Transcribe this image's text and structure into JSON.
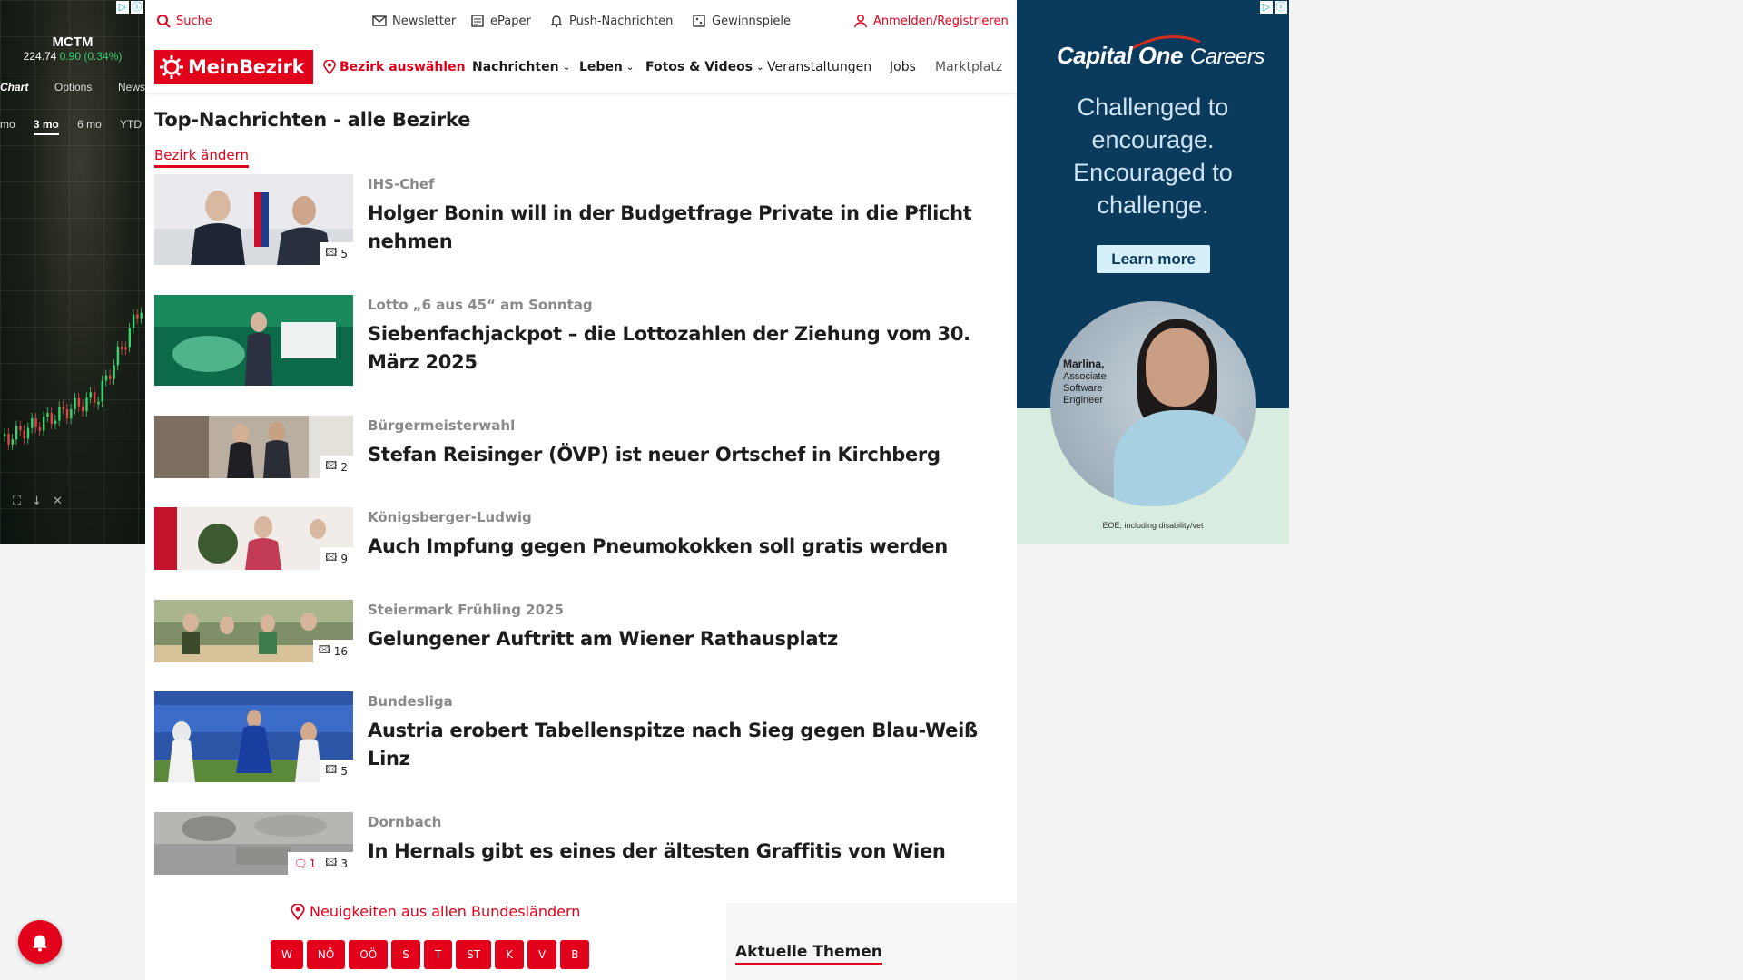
{
  "left_ad": {
    "symbol": "MCTM",
    "price": "224.74",
    "change": "0.90 (0.34%)",
    "tabs": [
      "Chart",
      "Options",
      "News"
    ],
    "ranges": [
      "mo",
      "3 mo",
      "6 mo",
      "YTD"
    ],
    "active_range": "3 mo",
    "colors": {
      "up": "#38d36e",
      "down": "#e24444"
    }
  },
  "util": {
    "search": "Suche",
    "newsletter": "Newsletter",
    "epaper": "ePaper",
    "push": "Push-Nachrichten",
    "games": "Gewinnspiele",
    "login": "Anmelden/Registrieren"
  },
  "nav": {
    "logo": "MeinBezirk",
    "select_district": "Bezirk auswählen",
    "items": [
      "Nachrichten",
      "Leben",
      "Fotos & Videos",
      "Veranstaltungen",
      "Jobs",
      "Marktplatz"
    ]
  },
  "section": {
    "title": "Top-Nachrichten - alle Bezirke",
    "change_link": "Bezirk ändern"
  },
  "articles": [
    {
      "kicker": "IHS-Chef",
      "headline": "Holger Bonin will in der Budgetfrage Private in die Pflicht nehmen",
      "photos": "5",
      "comments": ""
    },
    {
      "kicker": "Lotto „6 aus 45“ am Sonntag",
      "headline": "Siebenfachjackpot – die Lottozahlen der Ziehung vom 30. März 2025",
      "photos": "",
      "comments": ""
    },
    {
      "kicker": "Bürgermeisterwahl",
      "headline": "Stefan Reisinger (ÖVP) ist neuer Ortschef in Kirchberg",
      "photos": "2",
      "comments": ""
    },
    {
      "kicker": "Königsberger-Ludwig",
      "headline": "Auch Impfung gegen Pneumokokken soll gratis werden",
      "photos": "9",
      "comments": ""
    },
    {
      "kicker": "Steiermark Frühling 2025",
      "headline": "Gelungener Auftritt am Wiener Rathausplatz",
      "photos": "16",
      "comments": ""
    },
    {
      "kicker": "Bundesliga",
      "headline": "Austria erobert Tabellenspitze nach Sieg gegen Blau-Weiß Linz",
      "photos": "5",
      "comments": ""
    },
    {
      "kicker": "Dornbach",
      "headline": "In Hernals gibt es eines der ältesten Graffitis von Wien",
      "photos": "3",
      "comments": "1"
    }
  ],
  "footer": {
    "bundeslaender": "Neuigkeiten aus allen Bundesländern",
    "states": [
      "W",
      "NÖ",
      "OÖ",
      "S",
      "T",
      "ST",
      "K",
      "V",
      "B"
    ],
    "themen": "Aktuelle Themen"
  },
  "right_ad": {
    "brand": "Capital One",
    "careers": "Careers",
    "tagline": [
      "Challenged to",
      "encourage.",
      "Encouraged to",
      "challenge."
    ],
    "cta": "Learn more",
    "person_name": "Marlina,",
    "person_role": [
      "Associate",
      "Software",
      "Engineer"
    ],
    "legal": "EOE, including disability/vet"
  },
  "colors": {
    "brand_red": "#e2001a",
    "ad_navy": "#0a3a5c"
  }
}
